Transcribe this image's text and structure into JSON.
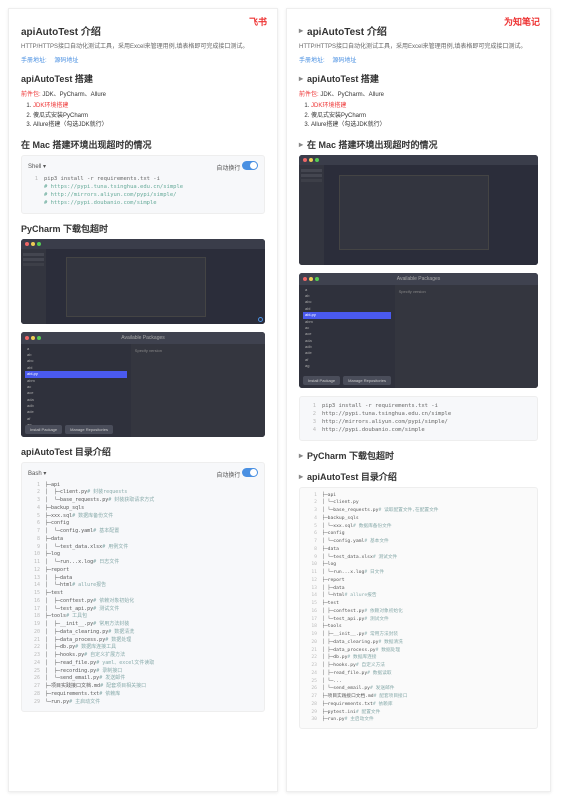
{
  "tags": {
    "left": "飞书",
    "right": "为知笔记"
  },
  "headings": {
    "intro": "apiAutoTest 介绍",
    "setup": "apiAutoTest 搭建",
    "mac": "在 Mac 搭建环境出现超时的情况",
    "pycharm": "PyCharm 下载包超时",
    "dir": "apiAutoTest 目录介绍"
  },
  "desc": "HTTP/HTTPS接口自动化测试工具，采用Excel来管理用例,填表格即可完成接口测试。",
  "links": {
    "manual": "手册地址:",
    "source": "源码地址"
  },
  "prereq": {
    "label": "前件包:",
    "value": "JDK、PyCharm、Allure"
  },
  "steps": [
    "JDK环境搭建",
    "傻瓜式安装PyCharm",
    "Allure搭建（勾选JDK就行）"
  ],
  "shell": {
    "header": "Shell ▾",
    "toggle_label": "自动换行",
    "lines": [
      {
        "n": "1",
        "t": "pip3 install -r requirements.txt -i"
      },
      {
        "n": "",
        "t": "# https://pypi.tuna.tsinghua.edu.cn/simple"
      },
      {
        "n": "",
        "t": "# http://mirrors.aliyun.com/pypi/simple/"
      },
      {
        "n": "",
        "t": "# https://pypi.doubanio.com/simple"
      }
    ]
  },
  "shell_r": {
    "lines": [
      {
        "n": "1",
        "t": "pip3 install -r requirements.txt -i"
      },
      {
        "n": "2",
        "t": "http://pypi.tuna.tsinghua.edu.cn/simple"
      },
      {
        "n": "3",
        "t": "http://mirrors.aliyun.com/pypi/simple/"
      },
      {
        "n": "4",
        "t": "http://pypi.doubanio.com/simple"
      }
    ]
  },
  "pkg": {
    "title": "Available Packages",
    "items": [
      "a",
      "ab",
      "abc",
      "abl",
      "abl-py",
      "abm",
      "ac",
      "ace",
      "ada",
      "adb",
      "ade",
      "af",
      "ag"
    ],
    "selected_index": 4,
    "desc_label": "Specify version",
    "btn_install": "Install Package",
    "btn_manage": "Manage Repositories"
  },
  "bash": {
    "header": "Bash ▾",
    "toggle_label": "自动换行"
  },
  "tree": [
    {
      "n": "1",
      "t": "├─api",
      "c": ""
    },
    {
      "n": "2",
      "t": "│  ├─client.py",
      "c": "# 封装requests"
    },
    {
      "n": "3",
      "t": "│  └─base_requests.py",
      "c": "# 封装获取请求方式"
    },
    {
      "n": "4",
      "t": "├─backup_sqls",
      "c": ""
    },
    {
      "n": "5",
      "t": "├─xxx.sql",
      "c": "# 数据库备份文件"
    },
    {
      "n": "6",
      "t": "├─config",
      "c": ""
    },
    {
      "n": "7",
      "t": "│  └─config.yaml",
      "c": "# 基本配置"
    },
    {
      "n": "8",
      "t": "├─data",
      "c": ""
    },
    {
      "n": "9",
      "t": "│  └─test_data.xlsx",
      "c": "# 用例文件"
    },
    {
      "n": "10",
      "t": "├─log",
      "c": ""
    },
    {
      "n": "11",
      "t": "│  └─run...x.log",
      "c": "# 日志文件"
    },
    {
      "n": "12",
      "t": "├─report",
      "c": ""
    },
    {
      "n": "13",
      "t": "│  ├─data",
      "c": ""
    },
    {
      "n": "14",
      "t": "│  └─html",
      "c": "# allure报告"
    },
    {
      "n": "15",
      "t": "├─test",
      "c": ""
    },
    {
      "n": "16",
      "t": "│  ├─conftest.py",
      "c": "# 依赖对象初始化"
    },
    {
      "n": "17",
      "t": "│  └─test_api.py",
      "c": "# 测试文件"
    },
    {
      "n": "18",
      "t": "├─tools",
      "c": "# 工具包"
    },
    {
      "n": "19",
      "t": "│  ├─__init__.py",
      "c": "# 常用方法封装"
    },
    {
      "n": "20",
      "t": "│  ├─data_clearing.py",
      "c": "# 数据清洗"
    },
    {
      "n": "21",
      "t": "│  ├─data_process.py",
      "c": "# 数据处理"
    },
    {
      "n": "22",
      "t": "│  ├─db.py",
      "c": "# 数据库连接工具"
    },
    {
      "n": "23",
      "t": "│  ├─hooks.py",
      "c": "# 自定义扩展方法"
    },
    {
      "n": "24",
      "t": "│  ├─read_file.py",
      "c": "# yaml、excel文件读取"
    },
    {
      "n": "25",
      "t": "│  ├─recording.py",
      "c": "# 录制接口"
    },
    {
      "n": "26",
      "t": "│  └─send_email.py",
      "c": "# 发送邮件"
    },
    {
      "n": "27",
      "t": "├─项目实践接口文档.md",
      "c": "# 配套项目相关接口"
    },
    {
      "n": "28",
      "t": "├─requirements.txt",
      "c": "# 依赖库"
    },
    {
      "n": "29",
      "t": "└─run.py",
      "c": "# 主启动文件"
    }
  ],
  "tree_r": [
    {
      "n": "1",
      "t": "├─api",
      "c": ""
    },
    {
      "n": "2",
      "t": "│ └─client.py",
      "c": ""
    },
    {
      "n": "3",
      "t": "│ └─base_requests.py",
      "c": "# 读取配置文件,在配置文件"
    },
    {
      "n": "4",
      "t": "├─backup_sqls",
      "c": ""
    },
    {
      "n": "5",
      "t": "│ └─xxx.sql",
      "c": "# 数据库备份文件"
    },
    {
      "n": "6",
      "t": "├─config",
      "c": ""
    },
    {
      "n": "7",
      "t": "│ └─config.yaml",
      "c": "# 基本文件"
    },
    {
      "n": "8",
      "t": "├─data",
      "c": ""
    },
    {
      "n": "9",
      "t": "│ └─test_data.xlsx",
      "c": "# 测试文件"
    },
    {
      "n": "10",
      "t": "├─log",
      "c": ""
    },
    {
      "n": "11",
      "t": "│ └─run...x.log",
      "c": "# 日文件"
    },
    {
      "n": "12",
      "t": "├─report",
      "c": ""
    },
    {
      "n": "13",
      "t": "│ ├─data",
      "c": ""
    },
    {
      "n": "14",
      "t": "│ └─html",
      "c": "# allure报告"
    },
    {
      "n": "15",
      "t": "├─test",
      "c": ""
    },
    {
      "n": "16",
      "t": "│ ├─conftest.py",
      "c": "# 依赖对象初始化"
    },
    {
      "n": "17",
      "t": "│ └─test_api.py",
      "c": "# 测试文件"
    },
    {
      "n": "18",
      "t": "├─tools",
      "c": ""
    },
    {
      "n": "19",
      "t": "│ ├─__init__.py",
      "c": "# 常用方法封装"
    },
    {
      "n": "20",
      "t": "│ ├─data_clearing.py",
      "c": "# 数据清洗"
    },
    {
      "n": "21",
      "t": "│ ├─data_process.py",
      "c": "# 数据处理"
    },
    {
      "n": "22",
      "t": "│ ├─db.py",
      "c": "# 数据库连接"
    },
    {
      "n": "23",
      "t": "│ ├─hooks.py",
      "c": "# 自定义方法"
    },
    {
      "n": "24",
      "t": "│ ├─read_file.py",
      "c": "# 数据读取"
    },
    {
      "n": "25",
      "t": "│ └─...",
      "c": ""
    },
    {
      "n": "26",
      "t": "│ └─send_email.py",
      "c": "# 发送邮件"
    },
    {
      "n": "27",
      "t": "├─项目实践接口文档.md",
      "c": "# 配套项目接口"
    },
    {
      "n": "28",
      "t": "├─requirements.txt",
      "c": "# 依赖库"
    },
    {
      "n": "29",
      "t": "├─pytest.ini",
      "c": "# 配置文件"
    },
    {
      "n": "30",
      "t": "├─run.py",
      "c": "# 主启动文件"
    }
  ]
}
